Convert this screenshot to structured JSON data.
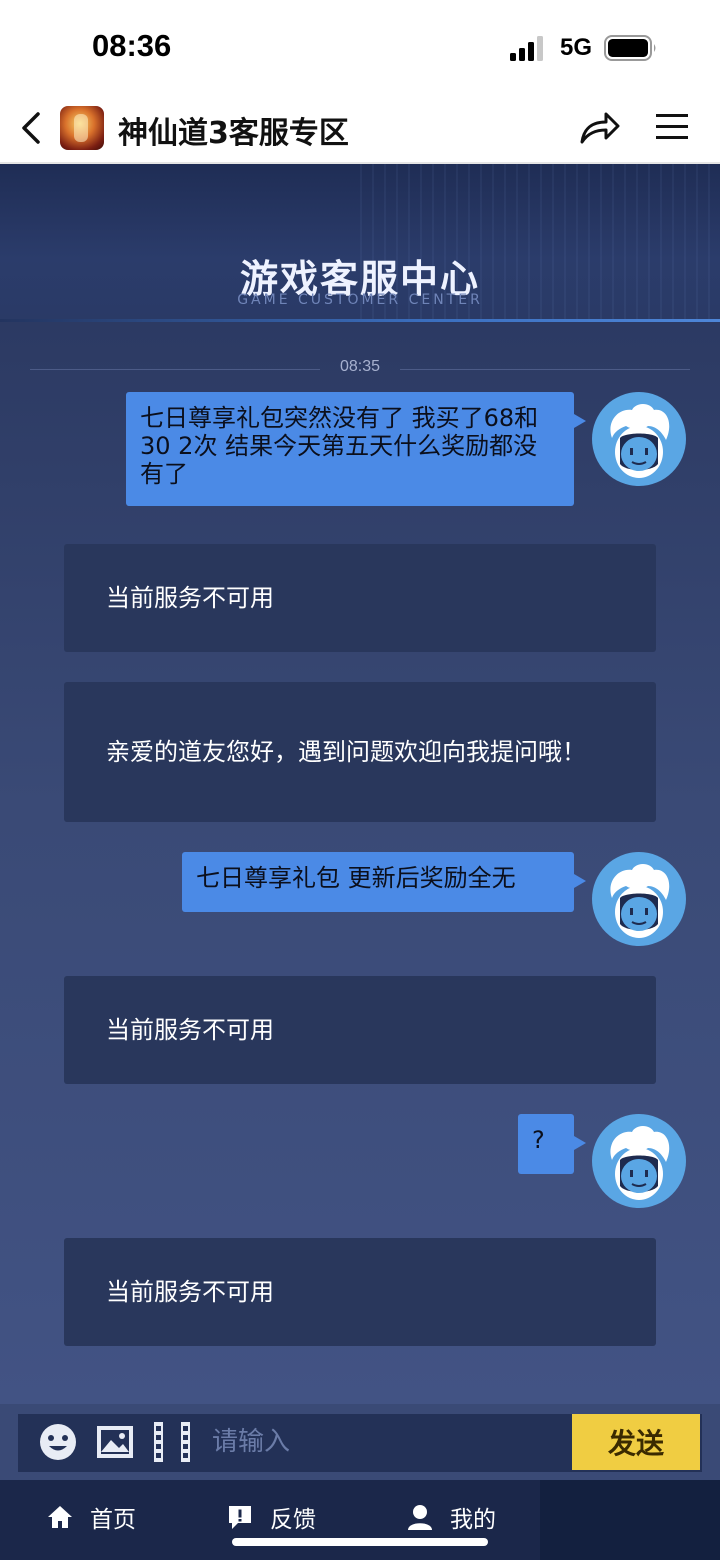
{
  "status_bar": {
    "time": "08:36",
    "network": "5G"
  },
  "nav": {
    "title": "神仙道3客服专区"
  },
  "banner": {
    "title": "游戏客服中心",
    "subtitle": "GAME CUSTOMER CENTER"
  },
  "chat": {
    "timestamp": "08:35",
    "messages": [
      {
        "from": "user",
        "text": "七日尊享礼包突然没有了 我买了68和30 2次 结果今天第五天什么奖励都没有了"
      },
      {
        "from": "bot",
        "text": "当前服务不可用"
      },
      {
        "from": "bot",
        "text": "亲爱的道友您好，遇到问题欢迎向我提问哦！"
      },
      {
        "from": "user",
        "text": "七日尊享礼包 更新后奖励全无"
      },
      {
        "from": "bot",
        "text": "当前服务不可用"
      },
      {
        "from": "user",
        "text": "?"
      },
      {
        "from": "bot",
        "text": "当前服务不可用"
      }
    ]
  },
  "input": {
    "placeholder": "请输入",
    "send_label": "发送"
  },
  "tabs": [
    {
      "label": "首页",
      "icon": "home-icon"
    },
    {
      "label": "反馈",
      "icon": "feedback-icon"
    },
    {
      "label": "我的",
      "icon": "user-icon"
    }
  ],
  "colors": {
    "user_bubble": "#4b8ae6",
    "bot_bubble": "#29375c",
    "send_button": "#f0cd42",
    "avatar": "#5aa6e4"
  }
}
